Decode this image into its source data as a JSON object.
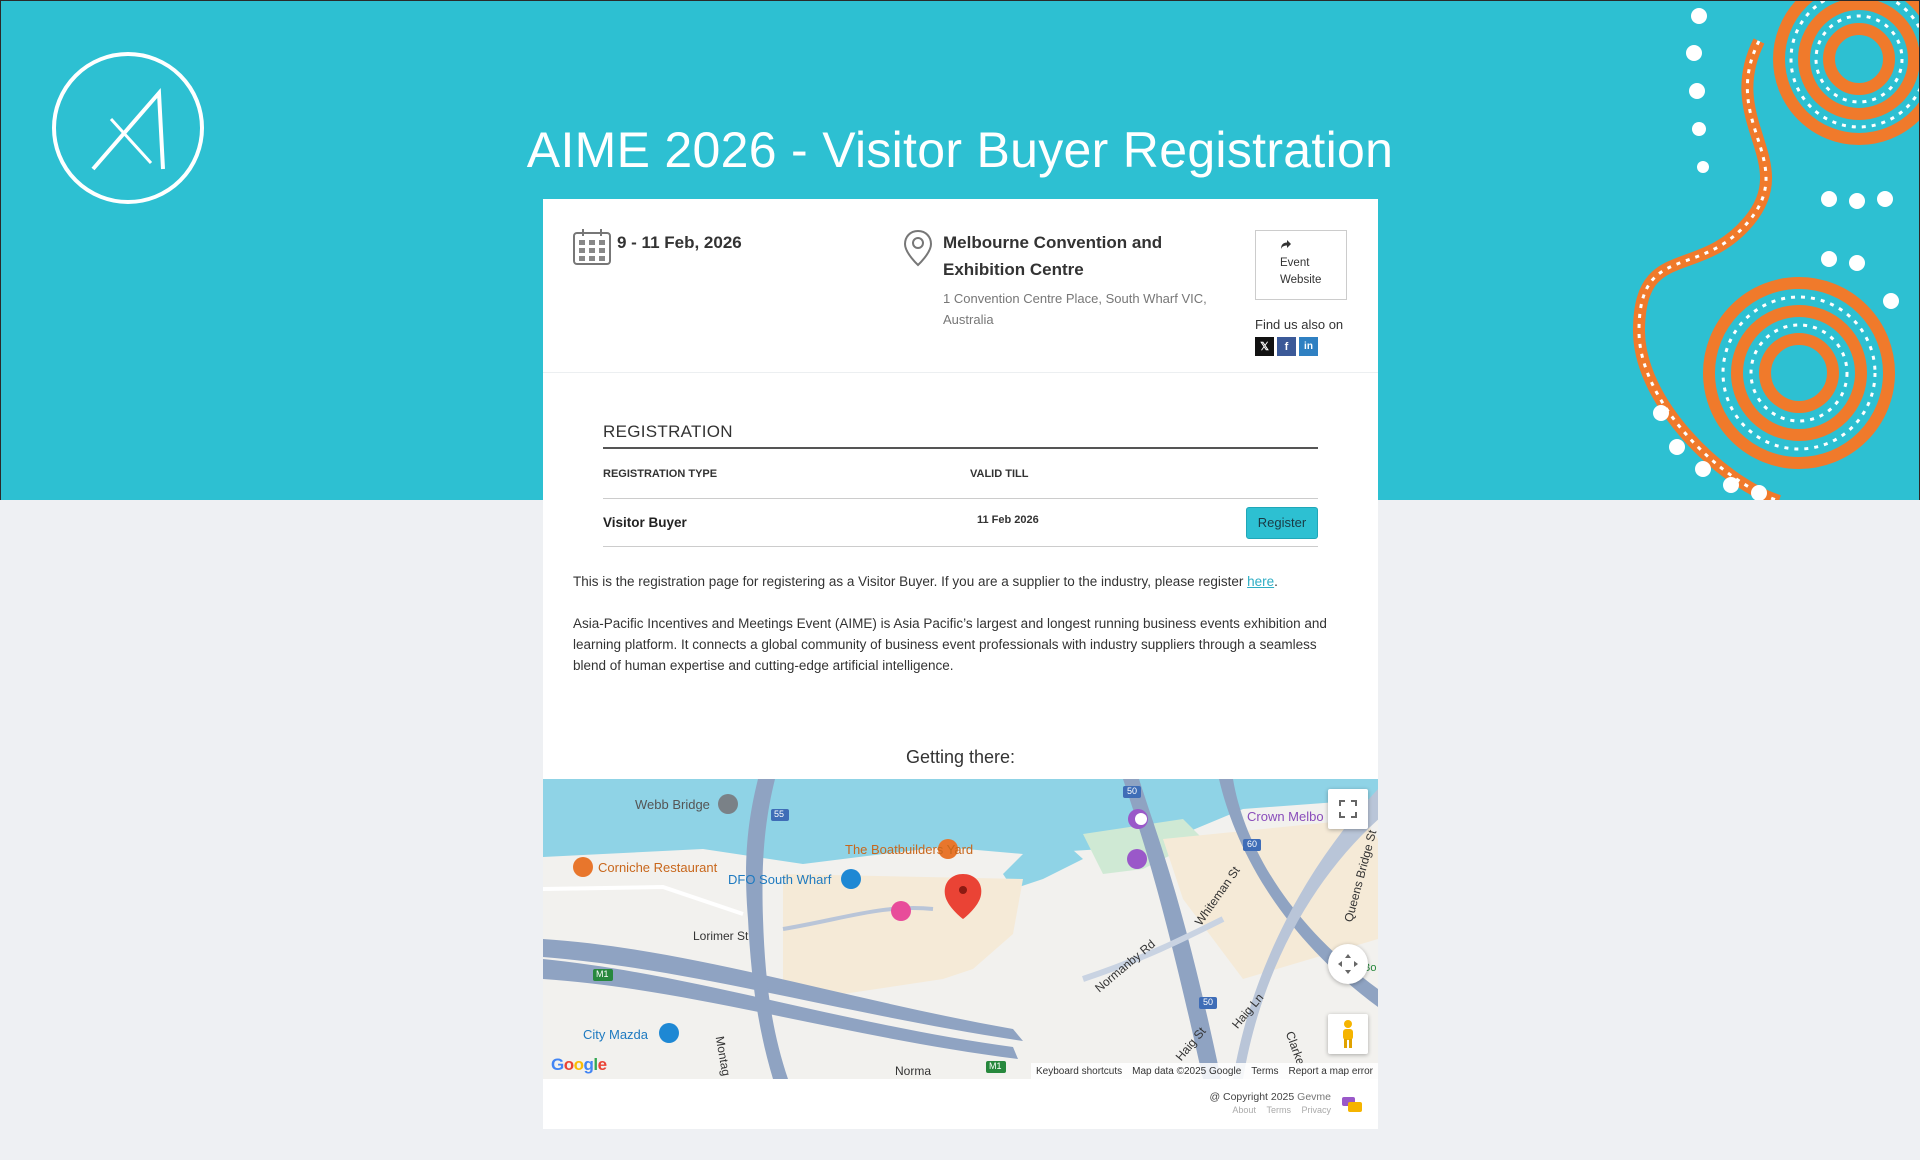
{
  "page": {
    "title": "AIME 2026 - Visitor Buyer Registration"
  },
  "event": {
    "date": "9 - 11 Feb, 2026",
    "venue_name": "Melbourne Convention and Exhibition Centre",
    "venue_address": "1 Convention Centre Place, South Wharf VIC, Australia",
    "website_label": "Event Website",
    "find_us_label": "Find us also on"
  },
  "socials": [
    {
      "name": "x-icon",
      "glyph": "𝕏"
    },
    {
      "name": "facebook-icon",
      "glyph": "f"
    },
    {
      "name": "linkedin-icon",
      "glyph": "in"
    }
  ],
  "registration": {
    "heading": "REGISTRATION",
    "col_type": "REGISTRATION TYPE",
    "col_valid": "VALID TILL",
    "rows": [
      {
        "type": "Visitor Buyer",
        "valid_till": "11 Feb 2026",
        "button": "Register"
      }
    ]
  },
  "description": {
    "intro_before": "This is the registration page for registering as a Visitor Buyer. If you are a supplier to the industry, please register ",
    "intro_link": "here",
    "intro_after": ".",
    "about": "Asia-Pacific Incentives and Meetings Event (AIME) is Asia Pacific’s largest and longest running business events exhibition and learning platform. It connects a global community of business event professionals with industry suppliers through a seamless blend of human expertise and cutting-edge artificial intelligence."
  },
  "map": {
    "heading": "Getting there:",
    "labels": {
      "webb_bridge": "Webb Bridge",
      "boatbuilders": "The Boatbuilders Yard",
      "corniche": "Corniche Restaurant",
      "dfo": "DFO South Wharf",
      "crown": "Crown Melbo",
      "lorimer": "Lorimer St",
      "normanby": "Normanby Rd",
      "whiteman": "Whiteman St",
      "queens_bridge": "Queens Bridge St",
      "city_mazda": "City Mazda",
      "haig_st": "Haig St",
      "haig_ln": "Haig Ln",
      "clarke": "Clarke",
      "montague": "Montag",
      "norma": "Norma",
      "road_55": "55",
      "road_50a": "50",
      "road_50b": "50",
      "road_60": "60",
      "road_m1a": "M1",
      "road_m1b": "M1",
      "bo": "Bo"
    },
    "google": "Google",
    "footer": {
      "shortcuts": "Keyboard shortcuts",
      "data": "Map data ©2025 Google",
      "terms": "Terms",
      "report": "Report a map error"
    }
  },
  "footer": {
    "copyright": "@ Copyright 2025",
    "brand": "Gevme",
    "about": "About",
    "terms": "Terms",
    "privacy": "Privacy"
  },
  "colors": {
    "brand_teal": "#2dc0d2",
    "deco_orange": "#f07a2b",
    "water": "#8fd3e6",
    "venue_area": "#f5ead7",
    "highway": "#8fa3c2"
  }
}
